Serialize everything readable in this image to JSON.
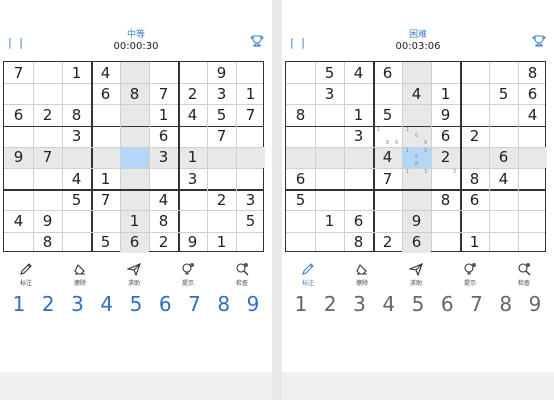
{
  "left": {
    "difficulty": "中等",
    "timer": "00:00:30",
    "pause_icon": "| |",
    "board": [
      [
        "7",
        "",
        "1",
        "4",
        "",
        "",
        "",
        "9",
        ""
      ],
      [
        "",
        "",
        "",
        "6",
        "8",
        "7",
        "2",
        "3",
        "1"
      ],
      [
        "6",
        "2",
        "8",
        "",
        "",
        "1",
        "4",
        "5",
        "7"
      ],
      [
        "",
        "",
        "3",
        "",
        "",
        "6",
        "",
        "7",
        ""
      ],
      [
        "9",
        "7",
        "",
        "",
        "",
        "3",
        "1",
        "",
        ""
      ],
      [
        "",
        "",
        "4",
        "1",
        "",
        "",
        "3",
        "",
        ""
      ],
      [
        "",
        "",
        "5",
        "7",
        "",
        "4",
        "",
        "2",
        "3"
      ],
      [
        "4",
        "9",
        "",
        "",
        "1",
        "8",
        "",
        "",
        "5"
      ],
      [
        "",
        "8",
        "",
        "5",
        "6",
        "2",
        "9",
        "1",
        ""
      ]
    ],
    "selected": [
      4,
      4
    ],
    "tools": [
      "标注",
      "擦除",
      "求助",
      "提示",
      "检查"
    ],
    "numbers": [
      "1",
      "2",
      "3",
      "4",
      "5",
      "6",
      "7",
      "8",
      "9"
    ],
    "number_color": "#2f6fc4"
  },
  "right": {
    "difficulty": "困难",
    "timer": "00:03:06",
    "pause_icon": "| |",
    "board": [
      [
        "",
        "5",
        "4",
        "6",
        "",
        "",
        "",
        "",
        "8"
      ],
      [
        "",
        "3",
        "",
        "",
        "4",
        "1",
        "",
        "5",
        "6"
      ],
      [
        "8",
        "",
        "1",
        "5",
        "",
        "9",
        "",
        "",
        "4"
      ],
      [
        "",
        "",
        "3",
        "",
        "",
        "6",
        "2",
        "",
        ""
      ],
      [
        "",
        "",
        "",
        "4",
        "",
        "2",
        "",
        "6",
        ""
      ],
      [
        "6",
        "",
        "",
        "7",
        "",
        "5",
        "8",
        "4",
        ""
      ],
      [
        "5",
        "",
        "",
        "",
        "",
        "8",
        "6",
        "",
        ""
      ],
      [
        "",
        "1",
        "6",
        "",
        "9",
        "",
        "",
        "",
        ""
      ],
      [
        "",
        "",
        "8",
        "2",
        "6",
        "",
        "1",
        "",
        ""
      ]
    ],
    "notes": {
      "3,3": [
        "1",
        "",
        "",
        "",
        "",
        "",
        "",
        "8",
        "9"
      ],
      "3,4": [
        "1",
        "",
        "",
        "",
        "6",
        "",
        "",
        "",
        "9"
      ],
      "4,4": [
        "1",
        "",
        "3",
        "",
        "5",
        "",
        "",
        "8",
        ""
      ],
      "5,4": [
        "1",
        "",
        "3",
        "",
        "",
        "",
        "",
        "",
        ""
      ],
      "5,5": [
        "",
        "",
        "3",
        "",
        "",
        "",
        "",
        "",
        ""
      ]
    },
    "selected": [
      4,
      4
    ],
    "tools": [
      "标注",
      "擦除",
      "求助",
      "提示",
      "检查"
    ],
    "numbers": [
      "1",
      "2",
      "3",
      "4",
      "5",
      "6",
      "7",
      "8",
      "9"
    ],
    "number_color": "#666666"
  }
}
